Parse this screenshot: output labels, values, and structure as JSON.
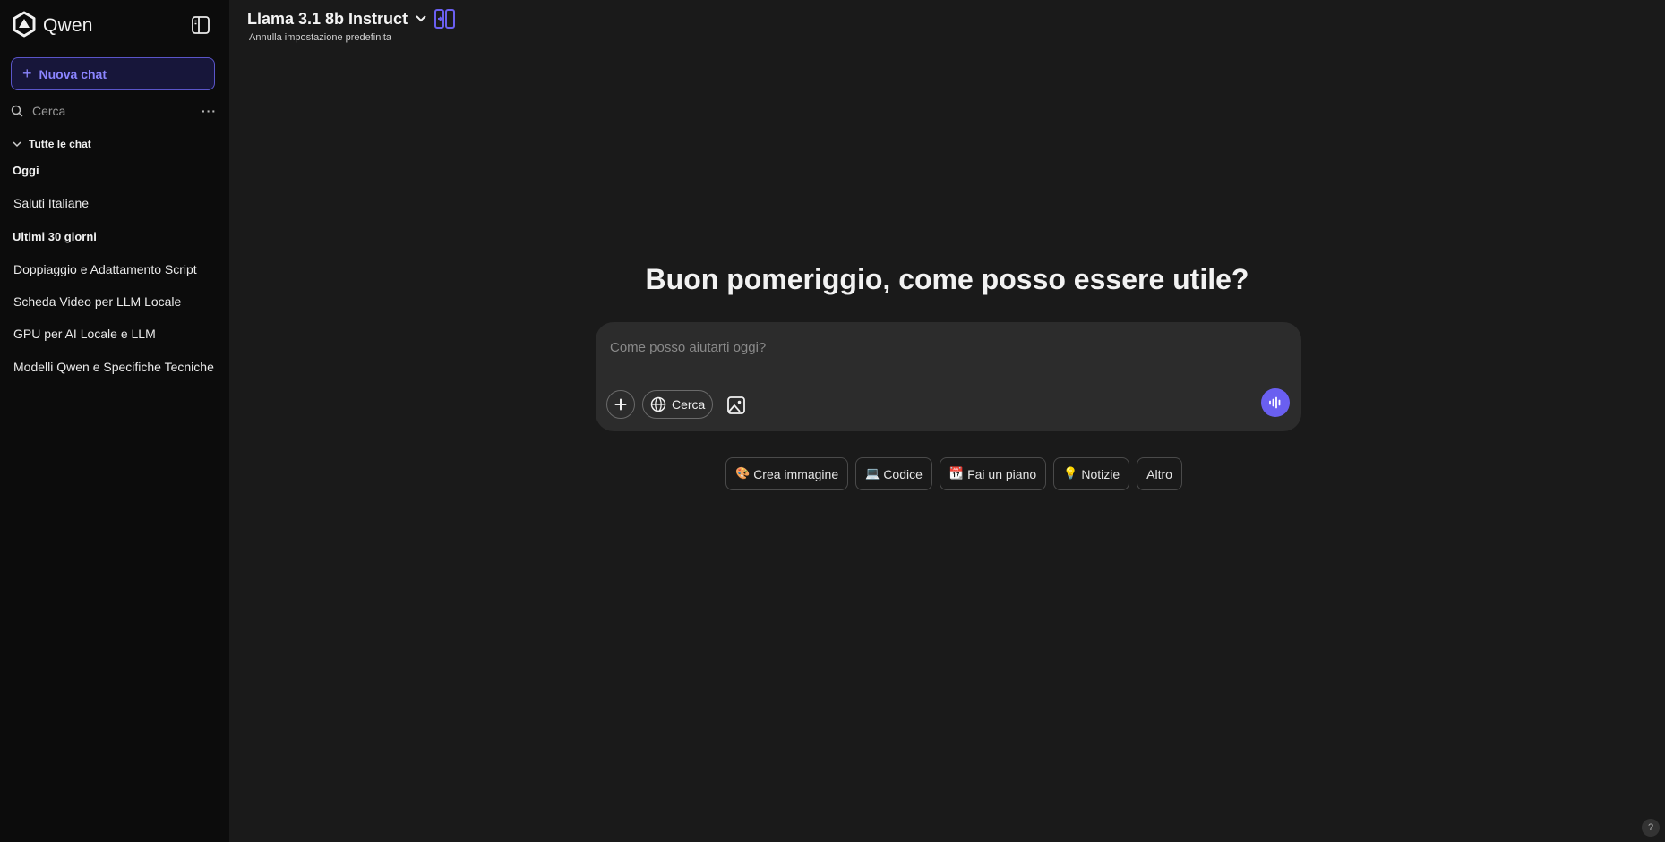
{
  "sidebar": {
    "brand": "Qwen",
    "new_chat_label": "Nuova chat",
    "search_label": "Cerca",
    "all_chats_label": "Tutte le chat",
    "groups": [
      {
        "label": "Oggi",
        "items": [
          "Saluti Italiane"
        ]
      },
      {
        "label": "Ultimi 30 giorni",
        "items": [
          "Doppiaggio e Adattamento Script",
          "Scheda Video per LLM Locale",
          "GPU per AI Locale e LLM",
          "Modelli Qwen e Specifiche Tecniche"
        ]
      }
    ]
  },
  "header": {
    "model_name": "Llama 3.1 8b Instruct",
    "set_default_label": "Annulla impostazione predefinita"
  },
  "main": {
    "greeting": "Buon pomeriggio, come posso essere utile?",
    "composer": {
      "placeholder": "Come posso aiutarti oggi?",
      "search_label": "Cerca"
    },
    "suggestions": [
      {
        "emoji": "🎨",
        "label": "Crea immagine"
      },
      {
        "emoji": "💻",
        "label": "Codice"
      },
      {
        "emoji": "📆",
        "label": "Fai un piano"
      },
      {
        "emoji": "💡",
        "label": "Notizie"
      },
      {
        "emoji": "",
        "label": "Altro"
      }
    ],
    "help_label": "?"
  },
  "colors": {
    "accent": "#6a5ff0",
    "sidebar_bg": "#0c0c0c",
    "main_bg": "#1a1a1a",
    "composer_bg": "#2c2c2c"
  },
  "icons": [
    "qwen-logo",
    "sidebar-toggle-icon",
    "plus-icon",
    "search-icon",
    "more-icon",
    "chevron-down-icon",
    "compare-icon",
    "globe-icon",
    "image-icon",
    "voice-icon",
    "help-icon"
  ]
}
